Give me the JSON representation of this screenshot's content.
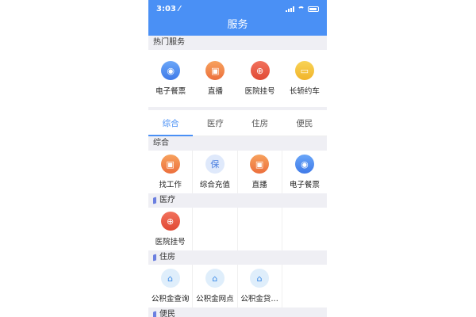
{
  "status": {
    "time": "3:03 ⁄"
  },
  "header": {
    "title": "服务"
  },
  "hot": {
    "title": "热门服务",
    "items": [
      {
        "label": "电子餐票",
        "icon": "ticket-icon",
        "glyph": "◉"
      },
      {
        "label": "直播",
        "icon": "live-icon",
        "glyph": "▣"
      },
      {
        "label": "医院挂号",
        "icon": "hospital-icon",
        "glyph": "⊕"
      },
      {
        "label": "长轿约车",
        "icon": "car-icon",
        "glyph": "▭"
      }
    ]
  },
  "tabs": [
    "综合",
    "医疗",
    "住房",
    "便民"
  ],
  "sections": {
    "general": {
      "title": "综合",
      "items": [
        {
          "label": "找工作",
          "glyph": "▣"
        },
        {
          "label": "综合充值",
          "glyph": "保"
        },
        {
          "label": "直播",
          "glyph": "▣"
        },
        {
          "label": "电子餐票",
          "glyph": "◉"
        }
      ]
    },
    "medical": {
      "title": "医疗",
      "items": [
        {
          "label": "医院挂号",
          "glyph": "⊕"
        }
      ]
    },
    "housing": {
      "title": "住房",
      "items": [
        {
          "label": "公积金查询",
          "glyph": "⌂"
        },
        {
          "label": "公积金网点",
          "glyph": "⌂"
        },
        {
          "label": "公积金贷…",
          "glyph": "⌂"
        }
      ]
    },
    "convenience": {
      "title": "便民"
    }
  }
}
